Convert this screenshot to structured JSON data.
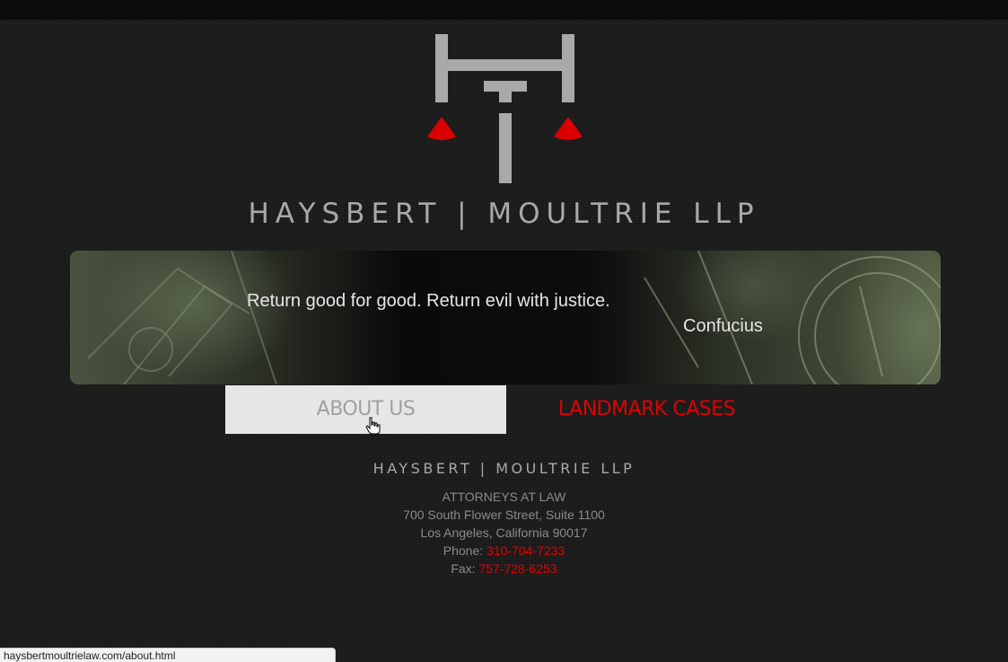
{
  "header": {
    "logo_icon": "scales-of-justice-monogram-icon",
    "firm_name": "HAYSBERT | MOULTRIE LLP"
  },
  "banner": {
    "quote": "Return good for good. Return evil with justice.",
    "author": "Confucius"
  },
  "nav": {
    "about_label": "ABOUT US",
    "cases_label": "LANDMARK CASES"
  },
  "footer": {
    "firm_name": "HAYSBERT | MOULTRIE LLP",
    "tagline": "ATTORNEYS AT LAW",
    "address1": "700 South Flower Street, Suite 1100",
    "address2": "Los Angeles, California 90017",
    "phone_label": "Phone:",
    "phone": "310-704-7233",
    "fax_label": "Fax:",
    "fax": "757-728-6253"
  },
  "statusbar": {
    "url": "haysbertmoultrielaw.com/about.html"
  },
  "colors": {
    "accent": "#e00000",
    "logo_gray": "#a9a9a9",
    "background": "#1c1c1c"
  }
}
